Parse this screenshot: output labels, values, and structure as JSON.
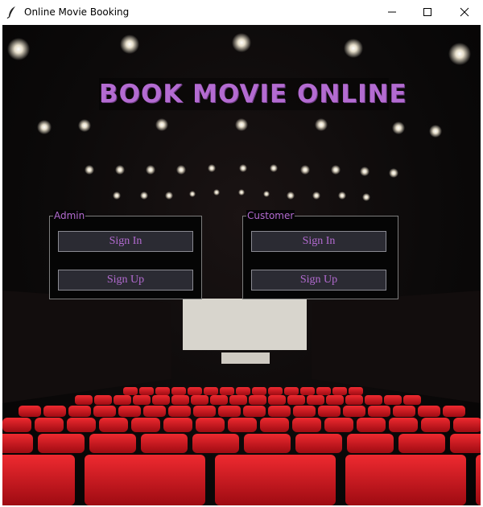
{
  "window": {
    "title": "Online Movie Booking",
    "icons": {
      "app": "feather-icon",
      "minimize": "minimize-icon",
      "maximize": "maximize-icon",
      "close": "close-icon"
    }
  },
  "main": {
    "heading": "BOOK MOVIE ONLINE",
    "admin": {
      "label": "Admin",
      "sign_in": "Sign In",
      "sign_up": "Sign Up"
    },
    "customer": {
      "label": "Customer",
      "sign_in": "Sign In",
      "sign_up": "Sign Up"
    }
  },
  "colors": {
    "accent": "#b36bd1",
    "button_bg": "#2b2b33",
    "seat_red": "#d11a22"
  }
}
